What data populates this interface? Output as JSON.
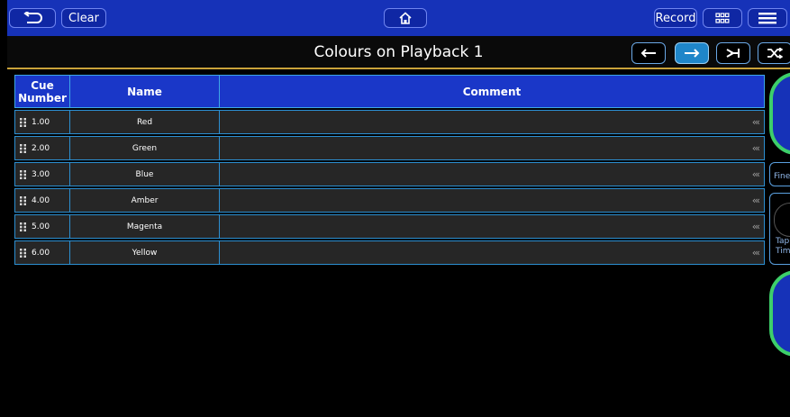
{
  "toolbar": {
    "back_icon": "return-arrow-icon",
    "clear_label": "Clear",
    "home_icon": "home-icon",
    "record_label": "Record",
    "grid_icon": "grid-icon",
    "menu_icon": "hamburger-menu-icon"
  },
  "title": "Colours on Playback 1",
  "nav_buttons": [
    {
      "icon": "arrow-left-icon"
    },
    {
      "icon": "arrow-right-icon",
      "active": true
    },
    {
      "icon": "skip-to-end-icon"
    },
    {
      "icon": "shuffle-icon"
    }
  ],
  "table": {
    "headers": {
      "cue": "Cue Number",
      "name": "Name",
      "comment": "Comment"
    },
    "rows": [
      {
        "cue": "1.00",
        "name": "Red",
        "comment": ""
      },
      {
        "cue": "2.00",
        "name": "Green",
        "comment": ""
      },
      {
        "cue": "3.00",
        "name": "Blue",
        "comment": ""
      },
      {
        "cue": "4.00",
        "name": "Amber",
        "comment": ""
      },
      {
        "cue": "5.00",
        "name": "Magenta",
        "comment": ""
      },
      {
        "cue": "6.00",
        "name": "Yellow",
        "comment": ""
      }
    ]
  },
  "right_panel": {
    "fine_label": "Fine",
    "tap_time_line1": "Tap",
    "tap_time_line2": "Time"
  },
  "colors": {
    "toolbar_bg": "#1632b8",
    "accent_gold": "#c9a23a",
    "row_border": "#2c8fd1",
    "dial_green": "#3dcf6a"
  }
}
